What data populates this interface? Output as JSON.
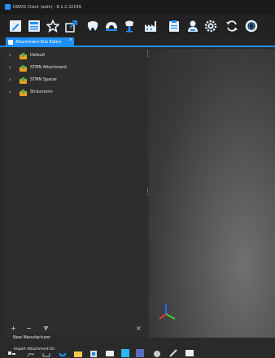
{
  "window": {
    "title": "DWOS Client (adm) - 8.1.2.32149"
  },
  "toolbar": {
    "icons": [
      "edit-icon",
      "list-icon",
      "star-icon",
      "export-icon",
      "tooth-crown-icon",
      "bridge-icon",
      "implant-icon",
      "factory-icon",
      "clipboard-icon",
      "user-icon",
      "settings-icon",
      "refresh-icon",
      "help-circle-icon"
    ]
  },
  "tabs": [
    {
      "label": "Attachment Kits Editor",
      "close": "×"
    }
  ],
  "tree": {
    "items": [
      {
        "label": "Default"
      },
      {
        "label": "STMN Attachment"
      },
      {
        "label": "STMN Spacer"
      },
      {
        "label": "Straumann"
      }
    ],
    "chevron": "›"
  },
  "panel_actions": {
    "add": "+",
    "remove": "−",
    "filter": "⧩",
    "close": "×"
  },
  "menu": {
    "new_manufacturer": "New Manufacturer",
    "import_kit": "Import Attachment Kit"
  },
  "colors": {
    "accent": "#1e90ff",
    "background": "#2a2a2a",
    "panel": "#2d2d2d"
  }
}
